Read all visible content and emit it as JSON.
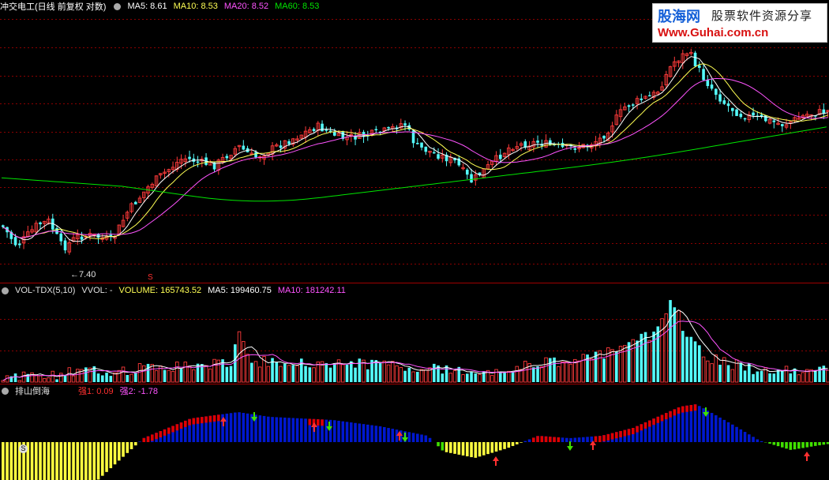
{
  "header": {
    "title": "冲交电工(日线 前复权 对数)",
    "ma5": "MA5: 8.61",
    "ma10": "MA10: 8.53",
    "ma20": "MA20: 8.52",
    "ma60": "MA60: 8.53"
  },
  "price_panel": {
    "low_marker": "←7.40",
    "signal_mark": "S"
  },
  "volume_panel": {
    "indicator_name": "VOL-TDX(5,10)",
    "vvol": "VVOL: -",
    "volume": "VOLUME: 165743.52",
    "ma5": "MA5: 199460.75",
    "ma10": "MA10: 181242.11"
  },
  "indicator_panel": {
    "name": "排山倒海",
    "qiang1": "强1: 0.09",
    "qiang2": "强2: -1.78",
    "marker": "S"
  },
  "watermark": {
    "brand": "股海网",
    "slogan": "股票软件资源分享",
    "url": "Www.Guhai.com.cn"
  },
  "colors": {
    "up": "#ff3b3b",
    "down": "#54fcfc",
    "ma5": "#ffffff",
    "ma10": "#ffff54",
    "ma20": "#ff54ff",
    "ma60": "#00e600",
    "grid": "#8b0000",
    "bar_red": "#e00000",
    "bar_blue": "#0018d0",
    "bar_yellow": "#ffff40",
    "bar_green": "#40e000"
  }
}
